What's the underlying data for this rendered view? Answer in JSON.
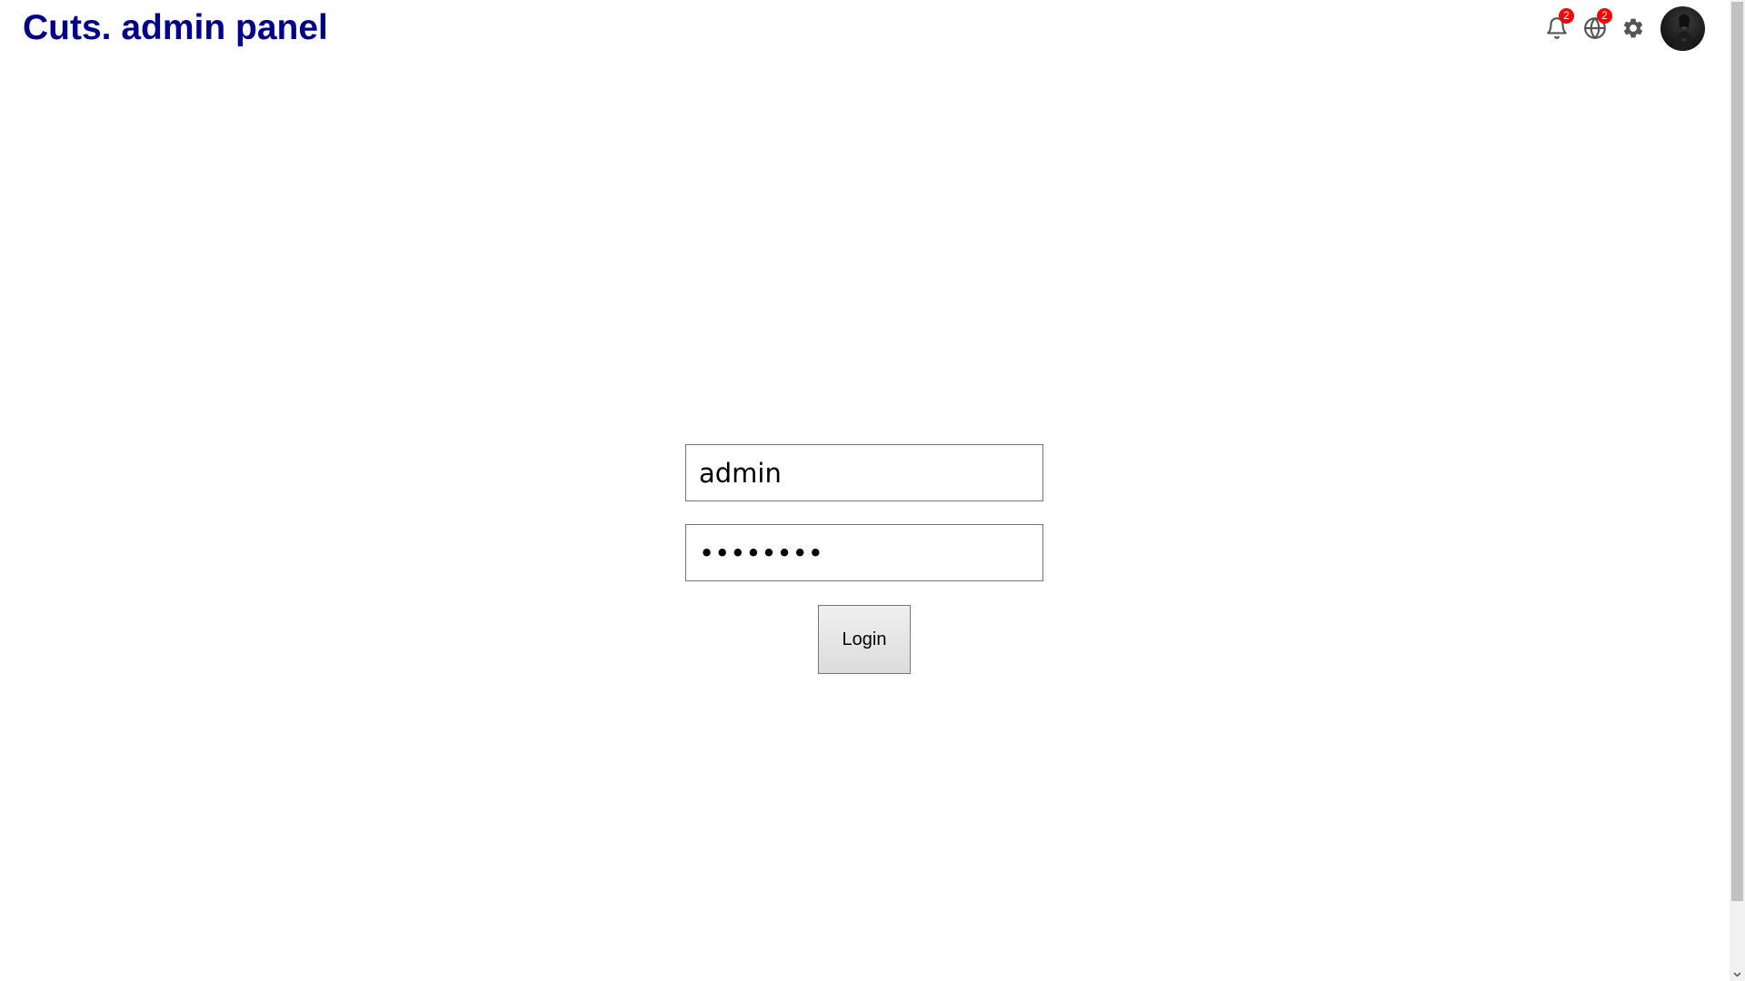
{
  "header": {
    "title": "Cuts. admin panel",
    "notifications": {
      "icon": "bell-icon",
      "count": "2"
    },
    "language": {
      "icon": "globe-icon",
      "count": "2"
    },
    "settings": {
      "icon": "gear-icon"
    },
    "profile": {
      "icon": "avatar"
    }
  },
  "login": {
    "username_value": "admin",
    "password_value": "password"
  },
  "buttons": {
    "login_label": "Login"
  },
  "colors": {
    "title": "#00008b",
    "badge": "#ff0000",
    "icon": "#555555"
  }
}
